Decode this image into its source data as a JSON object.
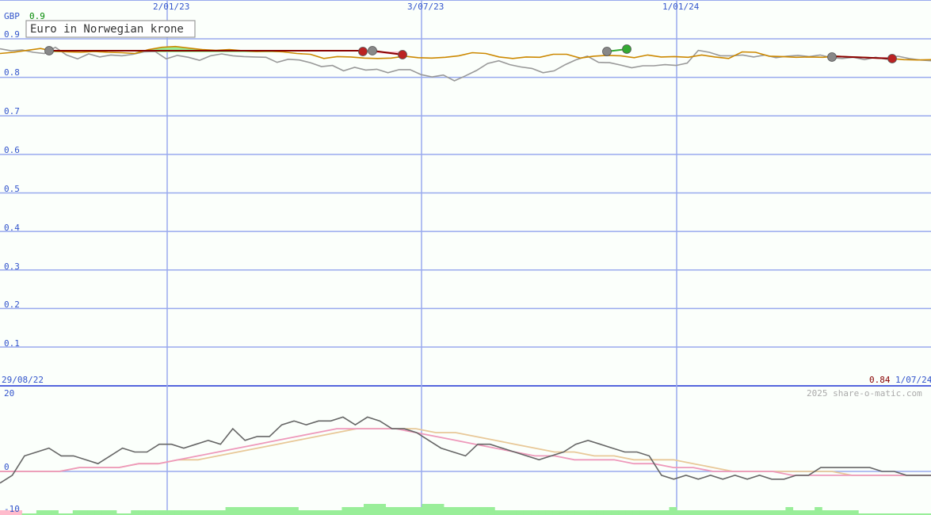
{
  "chart_data": [
    {
      "type": "line",
      "title": "Euro in Norwegian krone",
      "currency_label": "GBP",
      "range_max_label": "0.9",
      "last_value_label": "0.84",
      "start_date_label": "29/08/22",
      "end_date_label": "1/07/24",
      "x_tick_labels": [
        "2/01/23",
        "3/07/23",
        "1/01/24"
      ],
      "y_tick_labels": [
        "0.9",
        "0.8",
        "0.7",
        "0.6",
        "0.5",
        "0.4",
        "0.3",
        "0.2",
        "0.1"
      ],
      "ylim": [
        0.0,
        0.9
      ],
      "grid": true,
      "colors": {
        "background": "#fbfffb",
        "grid": "#99aaee",
        "axis_text": "#3355cc",
        "ma_line": "#cc8800",
        "price_line": "#999999",
        "gain_fill": "#99ee99",
        "loss_fill": "#ffbbcc",
        "trade_line": "#880000",
        "sell_marker": "#bb2222",
        "buy_marker": "#33aa33",
        "neutral_marker": "#888888",
        "range_max_color": "#008800",
        "last_value_color": "#880000"
      },
      "series": [
        {
          "kind": "price",
          "values": [
            0.874,
            0.869,
            0.871,
            0.865,
            0.862,
            0.878,
            0.858,
            0.848,
            0.861,
            0.853,
            0.858,
            0.856,
            0.86,
            0.866,
            0.867,
            0.848,
            0.857,
            0.852,
            0.844,
            0.856,
            0.861,
            0.856,
            0.854,
            0.853,
            0.852,
            0.839,
            0.847,
            0.845,
            0.838,
            0.828,
            0.831,
            0.817,
            0.826,
            0.819,
            0.821,
            0.812,
            0.82,
            0.82,
            0.807,
            0.801,
            0.806,
            0.791,
            0.804,
            0.818,
            0.836,
            0.843,
            0.833,
            0.827,
            0.823,
            0.812,
            0.817,
            0.833,
            0.846,
            0.855,
            0.839,
            0.838,
            0.832,
            0.825,
            0.83,
            0.83,
            0.833,
            0.831,
            0.837,
            0.87,
            0.865,
            0.856,
            0.856,
            0.858,
            0.853,
            0.858,
            0.851,
            0.855,
            0.857,
            0.854,
            0.858,
            0.851,
            0.849,
            0.852,
            0.846,
            0.852,
            0.847,
            0.855,
            0.849,
            0.845,
            0.843
          ]
        },
        {
          "kind": "moving-average",
          "values": [
            0.862,
            0.865,
            0.87,
            0.875,
            0.868,
            0.866,
            0.865,
            0.867,
            0.865,
            0.864,
            0.862,
            0.872,
            0.878,
            0.88,
            0.876,
            0.872,
            0.87,
            0.872,
            0.869,
            0.867,
            0.868,
            0.866,
            0.862,
            0.86,
            0.849,
            0.854,
            0.853,
            0.85,
            0.849,
            0.85,
            0.855,
            0.851,
            0.85,
            0.852,
            0.856,
            0.864,
            0.862,
            0.853,
            0.849,
            0.853,
            0.852,
            0.86,
            0.86,
            0.85,
            0.855,
            0.857,
            0.856,
            0.851,
            0.858,
            0.853,
            0.854,
            0.852,
            0.858,
            0.853,
            0.849,
            0.866,
            0.865,
            0.855,
            0.854,
            0.852,
            0.853,
            0.852,
            0.855,
            0.853,
            0.852,
            0.85,
            0.849,
            0.846,
            0.845,
            0.846
          ]
        }
      ]
    },
    {
      "type": "line",
      "ylim": [
        -10,
        20
      ],
      "y_tick_labels": [
        "20",
        "0",
        "-10"
      ],
      "watermark": "2025 share-o-matic.com",
      "colors": {
        "oscillator": "#666666",
        "signal_slow": "#e8c898",
        "signal_fast": "#ee99bb",
        "histogram_pos": "#99ee99",
        "histogram_neg": "#ffbbcc"
      },
      "series": [
        {
          "kind": "oscillator",
          "values": [
            -3,
            -1,
            4,
            5,
            6,
            4,
            4,
            3,
            2,
            4,
            6,
            5,
            5,
            7,
            7,
            6,
            7,
            8,
            7,
            11,
            8,
            9,
            9,
            12,
            13,
            12,
            13,
            13,
            14,
            12,
            14,
            13,
            11,
            11,
            10,
            8,
            6,
            5,
            4,
            7,
            7,
            6,
            5,
            4,
            3,
            4,
            5,
            7,
            8,
            7,
            6,
            5,
            5,
            4,
            -1,
            -2,
            -1,
            -2,
            -1,
            -2,
            -1,
            -2,
            -1,
            -2,
            -2,
            -1,
            -1,
            1,
            1,
            1,
            1,
            1,
            0,
            0,
            -1,
            -1,
            -1
          ]
        },
        {
          "kind": "signal-fast",
          "values": [
            0,
            0,
            0,
            0,
            1,
            1,
            1,
            2,
            2,
            3,
            4,
            5,
            6,
            7,
            8,
            9,
            10,
            11,
            11,
            11,
            11,
            10,
            9,
            8,
            7,
            6,
            5,
            4,
            4,
            3,
            3,
            3,
            2,
            2,
            1,
            1,
            0,
            0,
            0,
            0,
            -1,
            -1,
            -1,
            -1,
            -1,
            -1,
            -1,
            -1
          ]
        },
        {
          "kind": "signal-slow",
          "values": [
            0,
            0,
            0,
            0,
            1,
            1,
            1,
            2,
            2,
            3,
            3,
            4,
            5,
            6,
            7,
            8,
            9,
            10,
            11,
            11,
            11,
            11,
            10,
            10,
            9,
            8,
            7,
            6,
            5,
            5,
            4,
            4,
            3,
            3,
            3,
            2,
            1,
            0,
            0,
            0,
            0,
            0,
            0,
            -1,
            -1,
            -1,
            -1,
            -1
          ]
        },
        {
          "kind": "histogram",
          "values": [
            -1,
            -1,
            -1,
            0,
            0,
            1,
            1,
            1,
            0,
            0,
            1,
            1,
            1,
            1,
            1,
            1,
            0,
            0,
            1,
            1,
            1,
            1,
            1,
            1,
            1,
            1,
            1,
            1,
            1,
            1,
            1,
            2,
            2,
            2,
            2,
            2,
            2,
            2,
            2,
            2,
            2,
            1,
            1,
            1,
            1,
            1,
            1,
            2,
            2,
            2,
            3,
            3,
            3,
            2,
            2,
            2,
            2,
            2,
            3,
            3,
            3,
            2,
            2,
            2,
            2,
            2,
            2,
            2,
            1,
            1,
            1,
            1,
            1,
            1,
            1,
            1,
            1,
            1,
            1,
            1,
            1,
            1,
            1,
            1,
            1,
            1,
            1,
            1,
            1,
            1,
            1,
            1,
            2,
            1,
            1,
            1,
            1,
            1,
            1,
            1,
            1,
            1,
            1,
            1,
            1,
            1,
            1,
            1,
            2,
            1,
            1,
            1,
            2,
            1,
            1,
            1,
            1,
            1,
            0,
            0,
            0,
            0,
            0,
            0,
            0,
            0,
            0,
            0
          ]
        }
      ]
    }
  ]
}
